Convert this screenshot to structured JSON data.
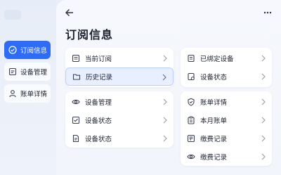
{
  "sidebar": {
    "items": [
      {
        "label": "订阅信息",
        "icon": "check-circle-icon",
        "active": true
      },
      {
        "label": "设备管理",
        "icon": "device-card-icon",
        "active": false
      },
      {
        "label": "账单详情",
        "icon": "user-icon",
        "active": false
      }
    ]
  },
  "header": {
    "title": "订阅信息"
  },
  "cards": {
    "subscription": [
      {
        "label": "当前订阅",
        "icon": "list-icon"
      },
      {
        "label": "历史记录",
        "icon": "folder-icon",
        "highlighted": true
      }
    ],
    "devices_bound": [
      {
        "label": "已绑定设备",
        "icon": "document-icon"
      },
      {
        "label": "设备状态",
        "icon": "document-check-icon"
      }
    ],
    "device_management": [
      {
        "label": "设备管理",
        "icon": "eye-icon"
      },
      {
        "label": "设备状态",
        "icon": "checklist-icon"
      },
      {
        "label": "设备状态",
        "icon": "file-icon"
      }
    ],
    "billing": [
      {
        "label": "账单详情",
        "icon": "shield-check-icon"
      },
      {
        "label": "本月账单",
        "icon": "clipboard-icon"
      },
      {
        "label": "缴费记录",
        "icon": "receipt-icon"
      },
      {
        "label": "缴费记录",
        "icon": "eye-icon"
      }
    ]
  },
  "colors": {
    "accent": "#2f6cf6",
    "highlight_bg": "#e8efff"
  }
}
